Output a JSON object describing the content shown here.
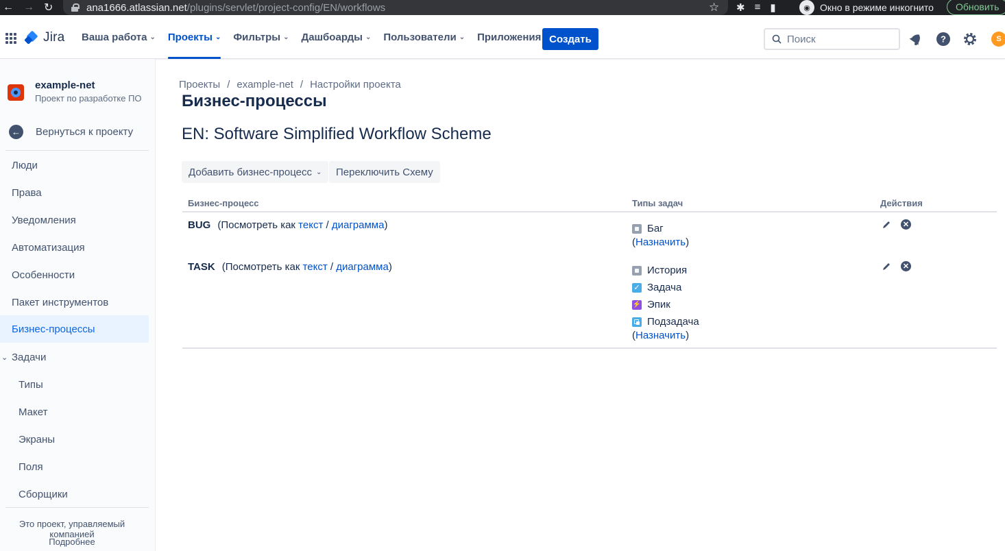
{
  "browser": {
    "url_host": "ana1666.atlassian.net",
    "url_path": "/plugins/servlet/project-config/EN/workflows",
    "incognito_label": "Окно в режиме инкогнито",
    "update_label": "Обновить"
  },
  "topnav": {
    "logo_text": "Jira",
    "menu": [
      {
        "label": "Ваша работа"
      },
      {
        "label": "Проекты"
      },
      {
        "label": "Фильтры"
      },
      {
        "label": "Дашбоарды"
      },
      {
        "label": "Пользователи"
      },
      {
        "label": "Приложения"
      }
    ],
    "active_menu": "Проекты",
    "create_label": "Создать",
    "search_placeholder": "Поиск",
    "avatar_initial": "S",
    "accent_color": "#0052cc"
  },
  "sidebar": {
    "project_name": "example-net",
    "project_type": "Проект по разработке ПО",
    "back_label": "Вернуться к проекту",
    "items": [
      {
        "label": "Люди"
      },
      {
        "label": "Права"
      },
      {
        "label": "Уведомления"
      },
      {
        "label": "Автоматизация"
      },
      {
        "label": "Особенности"
      },
      {
        "label": "Пакет инструментов"
      },
      {
        "label": "Бизнес-процессы"
      },
      {
        "label": "Задачи"
      }
    ],
    "selected": "Бизнес-процессы",
    "sub_items": [
      {
        "label": "Типы"
      },
      {
        "label": "Макет"
      },
      {
        "label": "Экраны"
      },
      {
        "label": "Поля"
      },
      {
        "label": "Сборщики"
      }
    ],
    "footer_text": "Это проект, управляемый компанией",
    "footer_link": "Подробнее"
  },
  "main": {
    "breadcrumbs": [
      "Проекты",
      "example-net",
      "Настройки проекта"
    ],
    "title": "Бизнес-процессы",
    "scheme_name": "EN: Software Simplified Workflow Scheme",
    "add_button": "Добавить бизнес-процесс",
    "switch_button": "Переключить Схему",
    "columns": {
      "workflow": "Бизнес-процесс",
      "issue_types": "Типы задач",
      "actions": "Действия"
    },
    "view_as": "(Посмотреть как",
    "text_link": "текст",
    "slash": "/",
    "diagram_link": "диаграмма",
    "close_paren": ")",
    "assign_link": "Назначить",
    "workflows": [
      {
        "name": "BUG",
        "issue_types": [
          {
            "label": "Баг",
            "icon": "bug-icon"
          }
        ]
      },
      {
        "name": "TASK",
        "issue_types": [
          {
            "label": "История",
            "icon": "story-icon"
          },
          {
            "label": "Задача",
            "icon": "task-icon"
          },
          {
            "label": "Эпик",
            "icon": "epic-icon"
          },
          {
            "label": "Подзадача",
            "icon": "subtask-icon"
          }
        ]
      }
    ]
  }
}
